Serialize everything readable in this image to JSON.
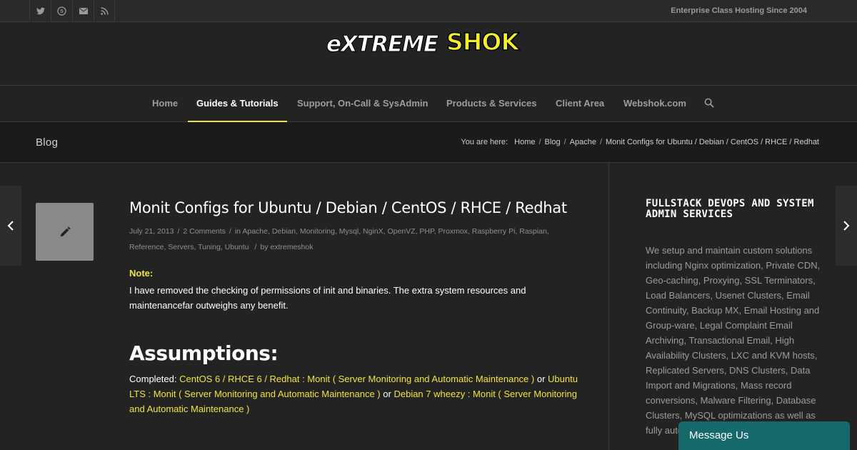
{
  "topbar": {
    "social": [
      "twitter-icon",
      "skype-icon",
      "mail-icon",
      "rss-icon"
    ],
    "tagline": "Enterprise Class Hosting Since 2004"
  },
  "logo": {
    "part1": "eXTREME",
    "part2": "SHOK"
  },
  "nav": {
    "items": [
      {
        "label": "Home"
      },
      {
        "label": "Guides & Tutorials"
      },
      {
        "label": "Support, On-Call & SysAdmin"
      },
      {
        "label": "Products & Services"
      },
      {
        "label": "Client Area"
      },
      {
        "label": "Webshok.com"
      }
    ],
    "active_index": 1,
    "search_icon": "search-icon"
  },
  "titlebar": {
    "title": "Blog",
    "breadcrumb_prefix": "You are here:",
    "breadcrumbs": [
      "Home",
      "Blog",
      "Apache",
      "Monit Configs for Ubuntu / Debian / CentOS / RHCE / Redhat"
    ]
  },
  "post": {
    "title": "Monit Configs for Ubuntu / Debian / CentOS / RHCE / Redhat",
    "date": "July 21, 2013",
    "comments": "2 Comments",
    "in_label": "in",
    "categories": "Apache, Debian, Monitoring, Mysql, NginX, OpenVZ, PHP, Proxmox, Raspberry Pi, Raspian, Reference, Servers, Tuning, Ubuntu",
    "by_label": "by",
    "author": "extremeshok",
    "note_label": "Note:",
    "note_text": "I have removed the checking of permissions of init and binaries. The extra system resources and maintenancefar outweighs any benefit.",
    "heading": "Assumptions:",
    "completed_label": "Completed:",
    "link1": "CentOS 6 / RHCE 6 / Redhat : Monit ( Server Monitoring and Automatic Maintenance )",
    "or1": "or",
    "link2": "Ubuntu LTS : Monit ( Server Monitoring and Automatic Maintenance )",
    "or2": "or",
    "link3": "Debian 7 wheezy : Monit ( Server Monitoring and Automatic Maintenance )"
  },
  "sidebar": {
    "title": "FULLSTACK DEVOPS AND SYSTEM ADMIN SERVICES",
    "text": "We setup and maintain custom solutions including Nginx optimization, Private CDN, Geo-caching, Proxying, SSL Terminators, Load Balancers, Usenet Clusters, Email Continuity, Backup MX, Email Hosting and Group-ware, Legal Complaint Email Archiving, Transactional Email, High Availability Clusters, LXC and KVM hosts, Replicated Servers, DNS Clusters, Data Import and Migrations, Mass record conversions, Malware Filtering, Database Clusters, MySQL optimizations as well as fully automated systems and managed"
  },
  "chat": {
    "label": "Message Us"
  },
  "colors": {
    "accent": "#f0e442",
    "background": "#232323",
    "chat": "#16696b"
  }
}
